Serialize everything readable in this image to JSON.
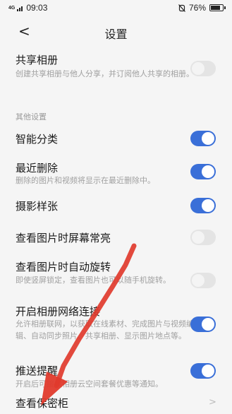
{
  "status": {
    "time": "09:03",
    "signal": "4G",
    "battery": "76%"
  },
  "header": {
    "title": "设置",
    "back_glyph": "<"
  },
  "items": [
    {
      "label": "共享相册",
      "desc": "创建共享相册与他人分享，并订阅他人共享的相册。",
      "toggle": "off"
    },
    {
      "label": "智能分类",
      "toggle": "on"
    },
    {
      "label": "最近删除",
      "desc": "删除的图片和视频将显示在最近删除中。",
      "toggle": "on"
    },
    {
      "label": "摄影样张",
      "toggle": "on"
    },
    {
      "label": "查看图片时屏幕常亮",
      "toggle": "off"
    },
    {
      "label": "查看图片时自动旋转",
      "desc": "即使竖屏锁定，查看图片也可以随手机旋转。",
      "toggle": "off"
    },
    {
      "label": "开启相册网络连接",
      "desc": "允许相册联网，以获取在线素材、完成图片与视频编辑、自动同步照片、共享相册、显示图片地点等。",
      "toggle": "on"
    },
    {
      "label": "推送提醒",
      "desc": "开启后可接收相册云空间套餐优惠等通知。",
      "toggle": "on"
    },
    {
      "label": "查看保密柜",
      "chevron": ">"
    }
  ],
  "section_other": "其他设置",
  "colors": {
    "accent": "#3a6fd8",
    "arrow": "#e03a2c"
  }
}
